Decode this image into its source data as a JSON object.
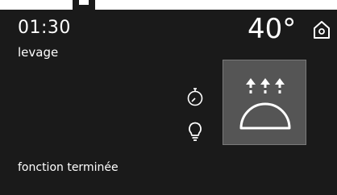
{
  "display": {
    "time": "01:30",
    "mode": "levage",
    "temperature": "40°",
    "status": "fonction terminée"
  },
  "icons": {
    "home": "home-icon",
    "timer": "stopwatch-icon",
    "light": "light-bulb-icon",
    "function": "rising-dough-icon"
  },
  "colors": {
    "background": "#1a1a1a",
    "tile": "#555555",
    "foreground": "#ffffff"
  }
}
